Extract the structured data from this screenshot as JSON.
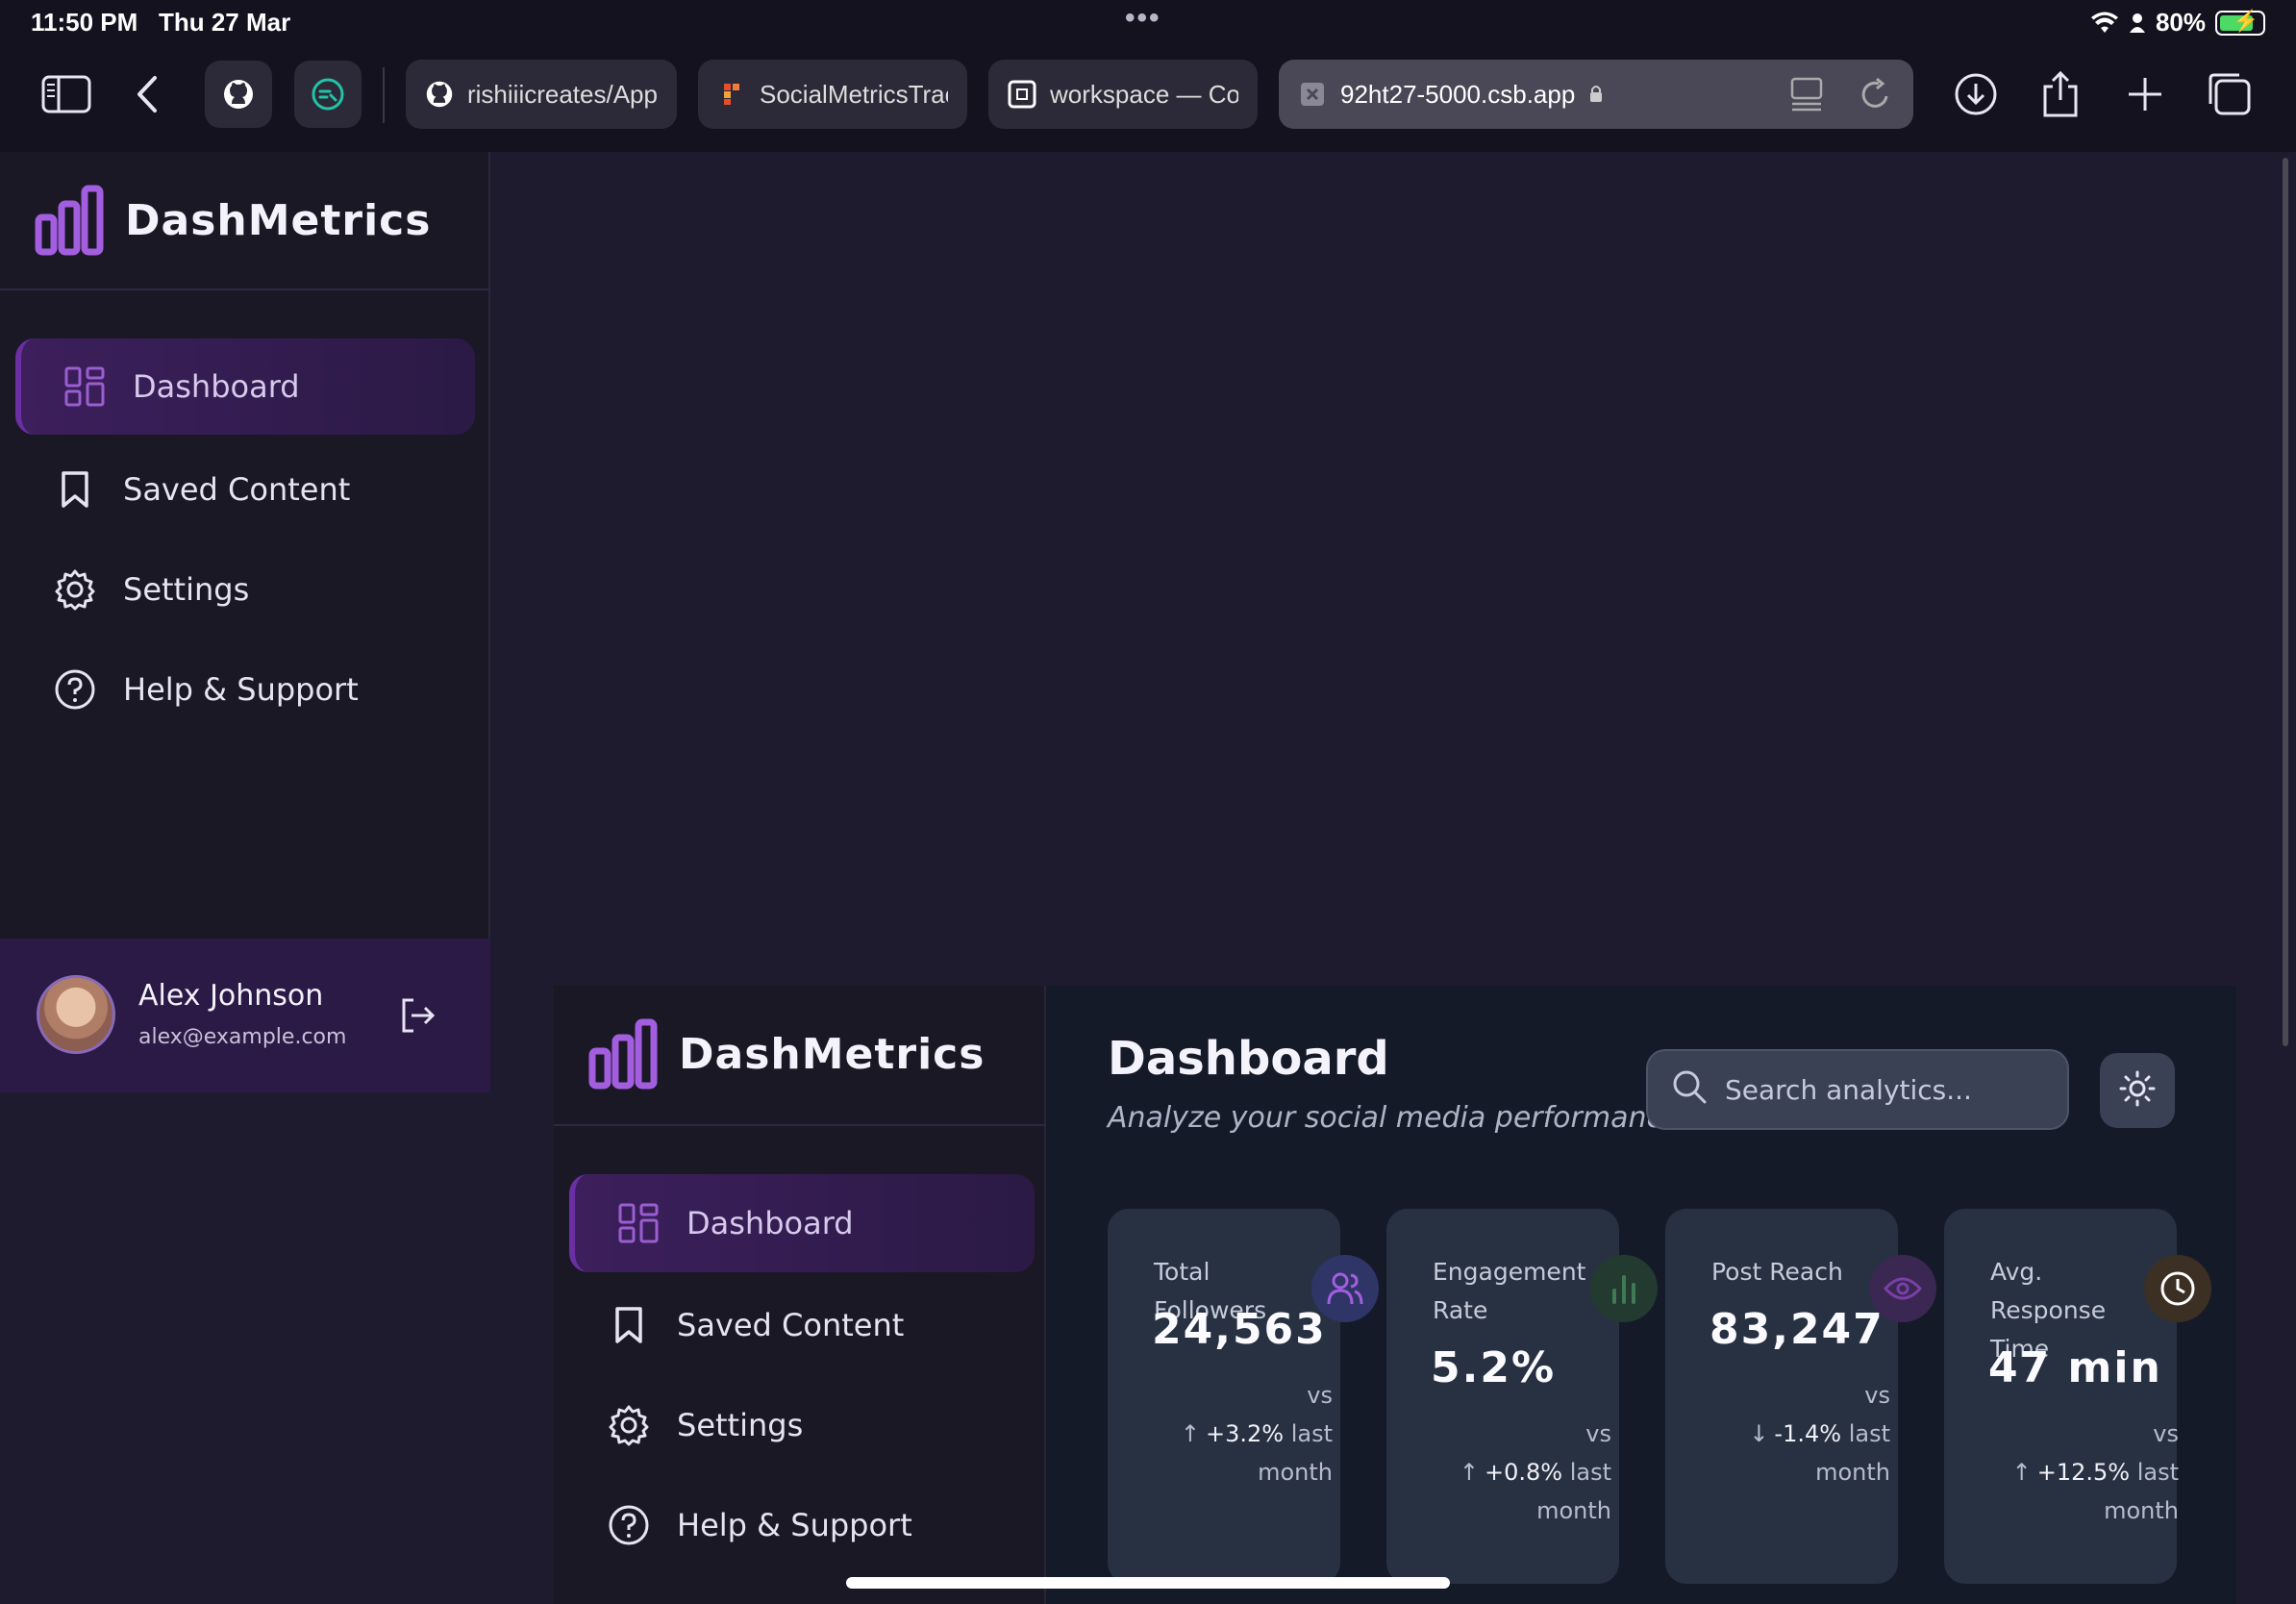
{
  "status_bar": {
    "time": "11:50 PM",
    "date": "Thu 27 Mar",
    "battery": "80%",
    "battery_level": 0.8
  },
  "browser": {
    "tabs": [
      {
        "label": "rishiiicreates/Apple",
        "icon": "github-icon"
      },
      {
        "label": "SocialMetricsTrack",
        "icon": "figma-icon"
      },
      {
        "label": "workspace — Cod",
        "icon": "codesandbox-icon"
      },
      {
        "label": "92ht27-5000.csb.app",
        "icon": "close-tab-icon",
        "active": true
      }
    ]
  },
  "app": {
    "brand": "DashMetrics",
    "nav": [
      {
        "label": "Dashboard",
        "icon": "grid-icon",
        "active": true
      },
      {
        "label": "Saved Content",
        "icon": "bookmark-icon"
      },
      {
        "label": "Settings",
        "icon": "gear-icon"
      },
      {
        "label": "Help & Support",
        "icon": "help-circle-icon"
      }
    ],
    "user": {
      "name": "Alex Johnson",
      "email": "alex@example.com"
    }
  },
  "dashboard": {
    "title": "Dashboard",
    "subtitle": "Analyze your social media performance",
    "search_placeholder": "Search analytics...",
    "cards": [
      {
        "label": "Total Followers",
        "value": "24,563",
        "change": "+3.2%",
        "direction": "up",
        "vs_text": "vs",
        "suffix": "last",
        "suffix2": "month",
        "icon": "users-icon",
        "icon_color": "#a35ee0",
        "icon_bg": "#2f3566"
      },
      {
        "label": "Engagement Rate",
        "value": "5.2%",
        "change": "+0.8%",
        "direction": "up",
        "vs_text": "vs",
        "suffix": "last",
        "suffix2": "month",
        "icon": "bar-chart-icon",
        "icon_color": "#3f7a55",
        "icon_bg": "#233a30"
      },
      {
        "label": "Post Reach",
        "value": "83,247",
        "change": "-1.4%",
        "direction": "down",
        "vs_text": "vs",
        "suffix": "last",
        "suffix2": "month",
        "icon": "eye-icon",
        "icon_color": "#7a3fa8",
        "icon_bg": "#3a2752"
      },
      {
        "label": "Avg. Response Time",
        "value": "47 min",
        "change": "+12.5%",
        "direction": "up",
        "vs_text": "vs",
        "suffix": "last",
        "suffix2": "month",
        "icon": "clock-icon",
        "icon_color": "#ffffff",
        "icon_bg": "#3c2f24"
      }
    ]
  },
  "colors": {
    "accent": "#a35ee0",
    "sidebar_active": "#3c1f5c",
    "background": "#1e1b2e"
  }
}
